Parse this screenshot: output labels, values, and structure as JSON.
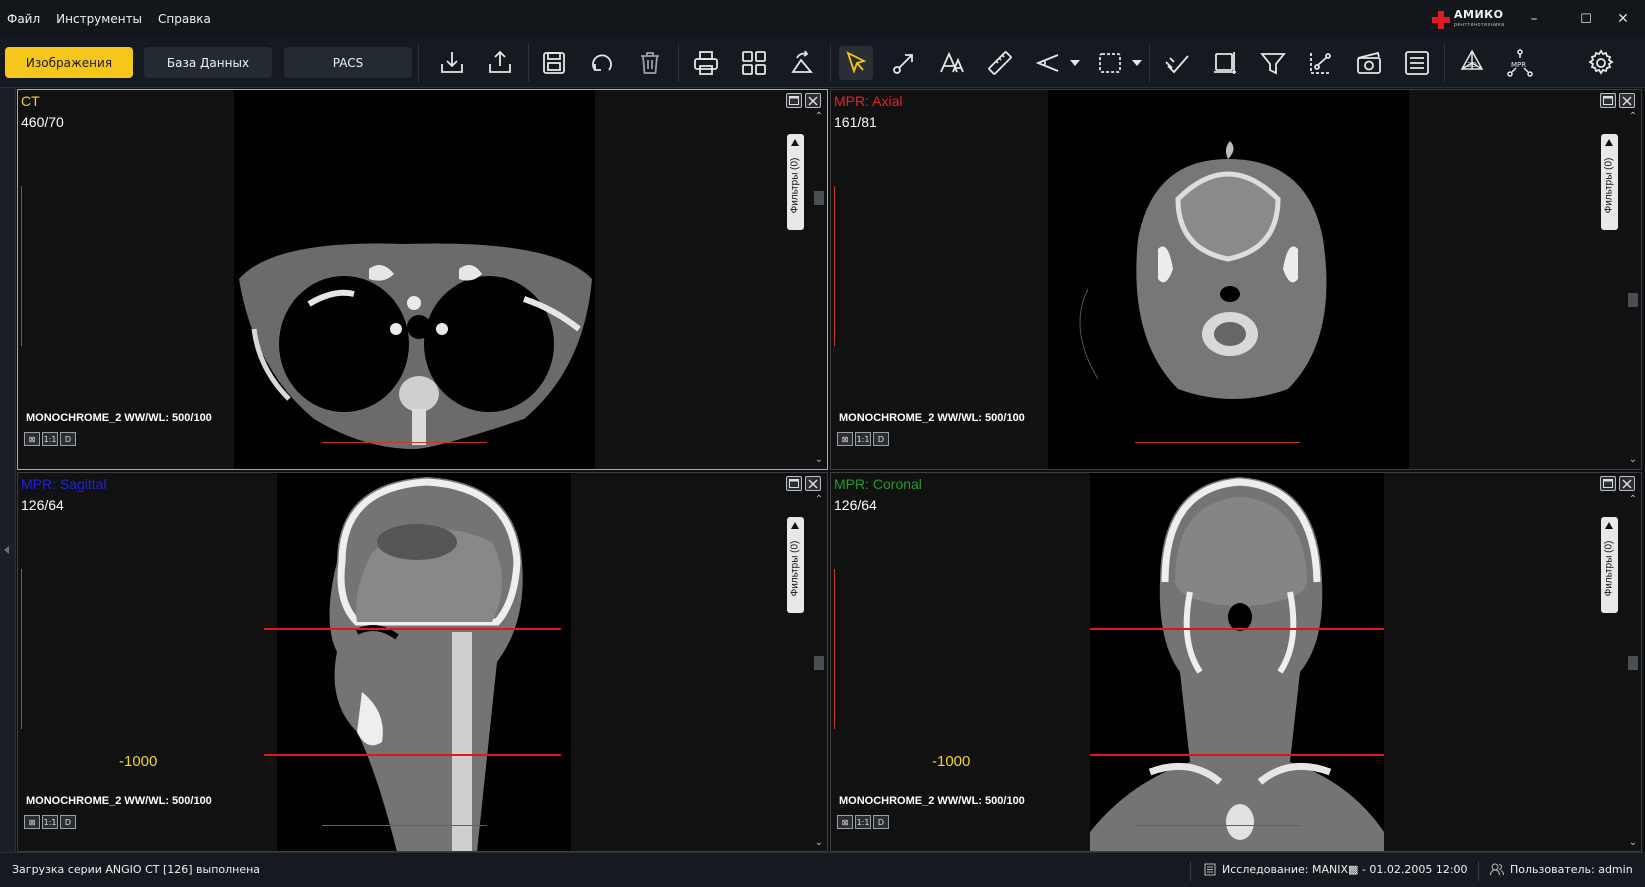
{
  "menu": {
    "file": "Файл",
    "tools": "Инструменты",
    "help": "Справка"
  },
  "logo": {
    "name": "АМИКО",
    "tagline": "рентгенотехника"
  },
  "window_controls": {
    "minimize": "–",
    "maximize": "☐",
    "close": "✕"
  },
  "tabs": [
    {
      "label": "Изображения",
      "active": true
    },
    {
      "label": "База Данных",
      "active": false
    },
    {
      "label": "PACS",
      "active": false
    }
  ],
  "toolbar_icons": [
    "import-icon",
    "export-icon",
    "save-icon",
    "rotate-reset-icon",
    "trash-icon",
    "print-icon",
    "layout-grid-icon",
    "rotate-icon",
    "pointer-icon",
    "arrow-annotation-icon",
    "text-annotation-icon",
    "ruler-icon",
    "angle-icon",
    "roi-select-icon",
    "calibrate-icon",
    "crop-icon",
    "filter-icon",
    "curve-measure-icon",
    "cine-icon",
    "report-icon",
    "volume-3d-icon",
    "mpr-icon",
    "settings-icon"
  ],
  "toolbar_text": {
    "volume_3d": "3D",
    "mpr": "MPR"
  },
  "viewports": [
    {
      "id": "ct",
      "title": "CT",
      "title_color": "#f3d61b",
      "wl": "460/70",
      "info": "MONOCHROME_2 WW/WL: 500/100",
      "hu": "",
      "filters": "Фильтры (0)",
      "active": true
    },
    {
      "id": "axial",
      "title": "MPR: Axial",
      "title_color": "#e5222a",
      "wl": "161/81",
      "info": "MONOCHROME_2 WW/WL: 500/100",
      "hu": "",
      "filters": "Фильтры (0)",
      "active": false
    },
    {
      "id": "sagittal",
      "title": "MPR: Sagittal",
      "title_color": "#2323d8",
      "wl": "126/64",
      "info": "MONOCHROME_2 WW/WL: 500/100",
      "hu": "-1000",
      "filters": "Фильтры (0)",
      "active": false
    },
    {
      "id": "coronal",
      "title": "MPR: Coronal",
      "title_color": "#229a2c",
      "wl": "126/64",
      "info": "MONOCHROME_2 WW/WL: 500/100",
      "hu": "-1000",
      "filters": "Фильтры (0)",
      "active": false
    }
  ],
  "viewport_buttons": {
    "reset": "⊠",
    "one_to_one": "1:1",
    "d": "D"
  },
  "status": {
    "message": "Загрузка серии ANGIO CT  [126] выполнена",
    "study": "Исследование: MANIX▩ - 01.02.2005 12:00",
    "user": "Пользователь: admin"
  }
}
